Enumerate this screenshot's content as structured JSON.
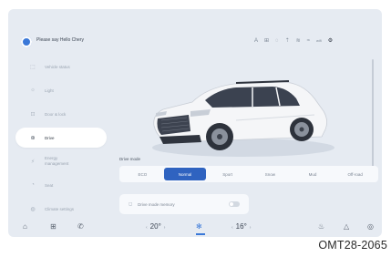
{
  "header": {
    "greeting": "Please say Hello Chery",
    "status_icons": [
      "A",
      "⊞",
      "◌",
      "⇡",
      "≋",
      "≈",
      "wifi",
      "⚙"
    ]
  },
  "sidebar": {
    "items": [
      {
        "icon": "car-outline-icon",
        "label": "Vehicle status"
      },
      {
        "icon": "light-icon",
        "label": "Light"
      },
      {
        "icon": "lock-icon",
        "label": "Door & lock"
      },
      {
        "icon": "steering-icon",
        "label": "Drive"
      },
      {
        "icon": "energy-icon",
        "label": "Energy management"
      },
      {
        "icon": "seat-icon",
        "label": "Seat"
      },
      {
        "icon": "climate-icon",
        "label": "Climate settings"
      }
    ],
    "active_index": 3
  },
  "drive_mode": {
    "label": "Drive mode",
    "options": [
      "ECO",
      "Normal",
      "Sport",
      "Snow",
      "Mud",
      "Off-road"
    ],
    "selected": "Normal"
  },
  "memory": {
    "label": "Drive mode memory",
    "enabled": false
  },
  "bottom": {
    "temp_left": "20°",
    "temp_right": "16°",
    "arrow_left": "‹",
    "arrow_right": "›"
  },
  "caption": "OMT28-2065",
  "colors": {
    "screen_bg": "#e6ebf2",
    "accent": "#2f63c0",
    "card": "#f7f9fc"
  }
}
